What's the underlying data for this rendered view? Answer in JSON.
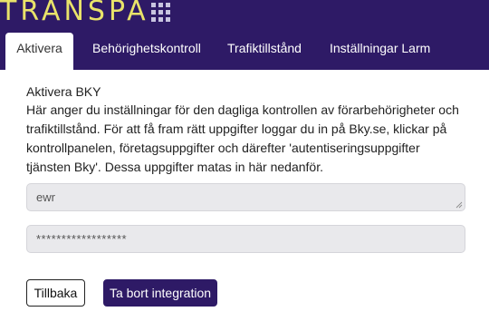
{
  "brand": {
    "logo_text": "TRANSPA",
    "grid_icon": "apps-grid-icon",
    "color": "#2e1a66",
    "logo_color": "#e9e36a"
  },
  "tabs": [
    {
      "label": "Aktivera",
      "active": true
    },
    {
      "label": "Behörighetskontroll",
      "active": false
    },
    {
      "label": "Trafiktillstånd",
      "active": false
    },
    {
      "label": "Inställningar Larm",
      "active": false
    }
  ],
  "main": {
    "heading": "Aktivera BKY",
    "description": "Här anger du inställningar för den dagliga kontrollen av förarbehörigheter och trafiktillstånd. För att få fram rätt uppgifter loggar du in på Bky.se, klickar på kon­trollpanelen, företagsuppgifter och därefter 'autentiseringsuppgifter tjänsten Bky'. Dessa uppgifter matas in här nedanför.",
    "username_value": "ewr",
    "password_value": "******************",
    "back_button": "Tillbaka",
    "remove_button": "Ta bort integration"
  }
}
